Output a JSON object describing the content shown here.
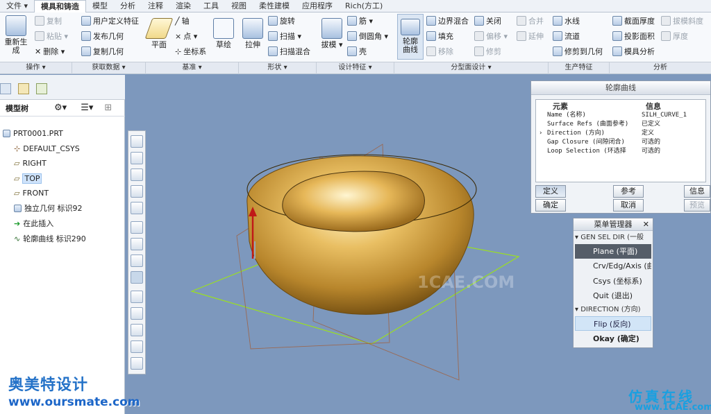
{
  "tabs": [
    "文件 ▾",
    "模具和铸造",
    "模型",
    "分析",
    "注释",
    "渲染",
    "工具",
    "视图",
    "柔性建模",
    "应用程序",
    "Rich(方工)"
  ],
  "ribbon": {
    "regen": "重新生成",
    "copy": "复制",
    "paste": "粘贴 ▾",
    "delete": "删除 ▾",
    "udf": "用户定义特征",
    "publish_geom": "发布几何",
    "copy_geom": "复制几何",
    "plane": "平面",
    "axis": "轴",
    "point": "点 ▾",
    "csys": "坐标系",
    "sketch": "草绘",
    "extrude": "拉伸",
    "revolve": "旋转",
    "sweep": "扫描 ▾",
    "swept_blend": "扫描混合",
    "draft": "拔模 ▾",
    "rib": "筋 ▾",
    "round": "倒圆角 ▾",
    "shell": "壳",
    "silh_curve": "轮廓\n曲线",
    "boundary_blend": "边界混合",
    "fill": "填充",
    "remove": "移除",
    "close": "关闭",
    "offset": "偏移 ▾",
    "trim": "修剪",
    "merge": "合并",
    "extend": "延伸",
    "waterline": "水线",
    "runner": "流道",
    "trim_to_geom": "修剪到几何",
    "section_thick": "截面厚度",
    "proj_area": "投影面积",
    "mold_analysis": "模具分析",
    "draft_check": "拔模斜度",
    "thickness": "厚度"
  },
  "groups": [
    "操作 ▾",
    "获取数据 ▾",
    "基准 ▾",
    "形状 ▾",
    "设计特征 ▾",
    "分型面设计 ▾",
    "生产特征",
    "分析"
  ],
  "tree": {
    "header": "模型树",
    "items": [
      "PRT0001.PRT",
      "DEFAULT_CSYS",
      "RIGHT",
      "TOP",
      "FRONT",
      "独立几何 标识92",
      "在此插入",
      "轮廓曲线 标识290"
    ]
  },
  "silh_dialog": {
    "title": "轮廓曲线",
    "col_element": "元素",
    "col_info": "信息",
    "rows": [
      {
        "element": "Name (名称)",
        "info": "SILH_CURVE_1"
      },
      {
        "element": "Surface Refs (曲面参考)",
        "info": "已定义"
      },
      {
        "element": "Direction (方向)",
        "info": "定义"
      },
      {
        "element": "Gap Closure (间隙闭合)",
        "info": "可选的"
      },
      {
        "element": "Loop Selection (环选择",
        "info": "可选的"
      }
    ],
    "btn_define": "定义",
    "btn_ref": "参考",
    "btn_info": "信息",
    "btn_ok": "确定",
    "btn_cancel": "取消",
    "btn_preview": "预览"
  },
  "menu_mgr": {
    "title": "菜单管理器",
    "sec1": "GEN SEL DIR (一般",
    "items1": [
      "Plane (平面)",
      "Crv/Edg/Axis (曲",
      "Csys (坐标系)",
      "Quit (退出)"
    ],
    "sec2": "DIRECTION (方向)",
    "items2": [
      "Flip (反向)",
      "Okay (确定)"
    ]
  },
  "watermarks": {
    "brand_cn": "奥美特设计",
    "brand_url": "www.oursmate.com",
    "sim_cn": "仿真在线",
    "sim_url": "www.1CAE.com",
    "center": "1CAE.COM"
  },
  "colors": {
    "viewport": "#7d98bd",
    "model_gold": "#c99a3e",
    "datum_green": "#9be01f",
    "datum_brown": "#a06040"
  }
}
